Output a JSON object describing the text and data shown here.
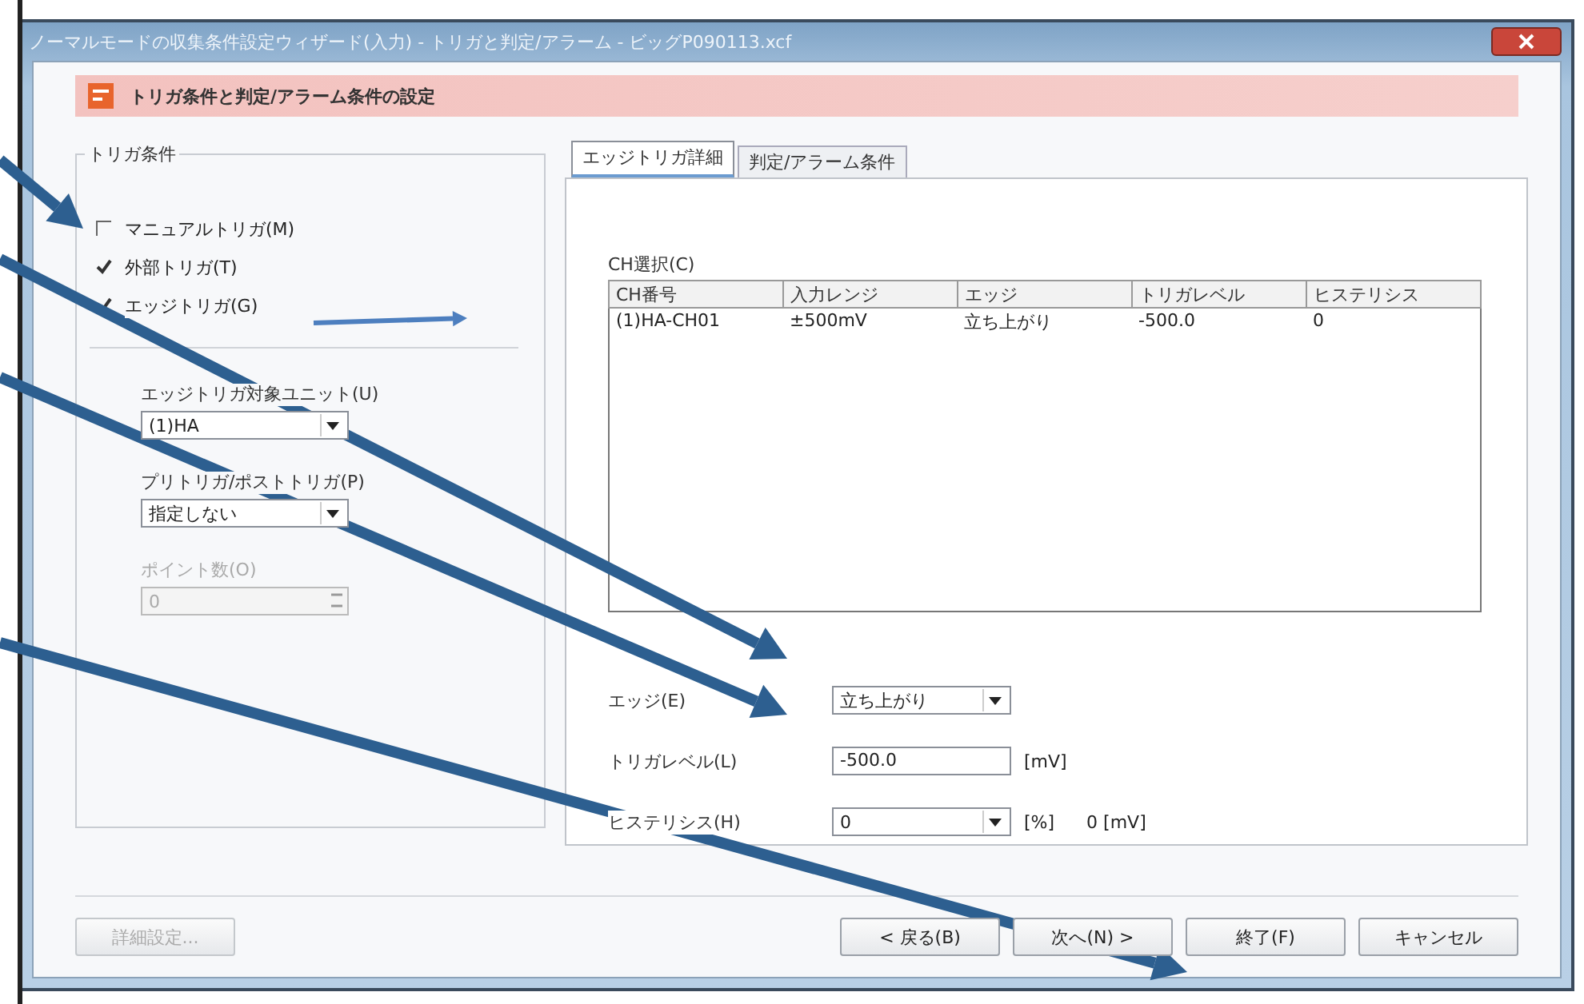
{
  "window": {
    "title": "ノーマルモードの収集条件設定ウィザード(入力) - トリガと判定/アラーム - ビッグP090113.xcf"
  },
  "header": {
    "title": "トリガ条件と判定/アラーム条件の設定"
  },
  "trigger_group": {
    "title": "トリガ条件",
    "options": [
      {
        "label": "マニュアルトリガ(M)",
        "checked": false
      },
      {
        "label": "外部トリガ(T)",
        "checked": true
      },
      {
        "label": "エッジトリガ(G)",
        "checked": true
      }
    ],
    "fields": [
      {
        "label": "エッジトリガ対象ユニット(U)",
        "kind": "dropdown",
        "value": "(1)HA",
        "disabled": false
      },
      {
        "label": "プリトリガ/ポストトリガ(P)",
        "kind": "dropdown",
        "value": "指定しない",
        "disabled": false
      },
      {
        "label": "ポイント数(O)",
        "kind": "spinner",
        "value": "0",
        "disabled": true
      }
    ]
  },
  "tabs": [
    {
      "label": "エッジトリガ詳細",
      "selected": true
    },
    {
      "label": "判定/アラーム条件",
      "selected": false
    }
  ],
  "channel_list": {
    "label": "CH選択(C)",
    "columns": [
      "CH番号",
      "入力レンジ",
      "エッジ",
      "トリガレベル",
      "ヒステリシス"
    ],
    "rows": [
      [
        "(1)HA-CH01",
        "±500mV",
        "立ち上がり",
        "-500.0",
        "0"
      ]
    ]
  },
  "edge_settings": [
    {
      "label": "エッジ(E)",
      "kind": "dropdown",
      "value": "立ち上がり"
    },
    {
      "label": "トリガレベル(L)",
      "kind": "input",
      "value": "-500.0",
      "unit": "[mV]"
    },
    {
      "label": "ヒステリシス(H)",
      "kind": "dropdown",
      "value": "0",
      "unit": "[%]",
      "note": "0 [mV]"
    }
  ],
  "buttons": [
    {
      "label": "詳細設定...",
      "disabled": true
    },
    {
      "label": "< 戻る(B)",
      "disabled": false
    },
    {
      "label": "次へ(N) >",
      "disabled": false
    },
    {
      "label": "終了(F)",
      "disabled": false
    },
    {
      "label": "キャンセル",
      "disabled": false
    }
  ]
}
